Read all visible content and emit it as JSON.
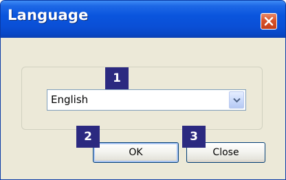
{
  "window": {
    "title": "Language"
  },
  "language": {
    "selected": "English"
  },
  "buttons": {
    "ok_label": "OK",
    "close_label": "Close"
  },
  "markers": [
    "1",
    "2",
    "3"
  ],
  "icons": {
    "close": "close-icon",
    "dropdown": "chevron-down-icon"
  },
  "colors": {
    "titlebar": "#0a55dd",
    "close_button": "#d8532a",
    "marker": "#2b2980",
    "dialog_bg": "#ece9d8"
  }
}
